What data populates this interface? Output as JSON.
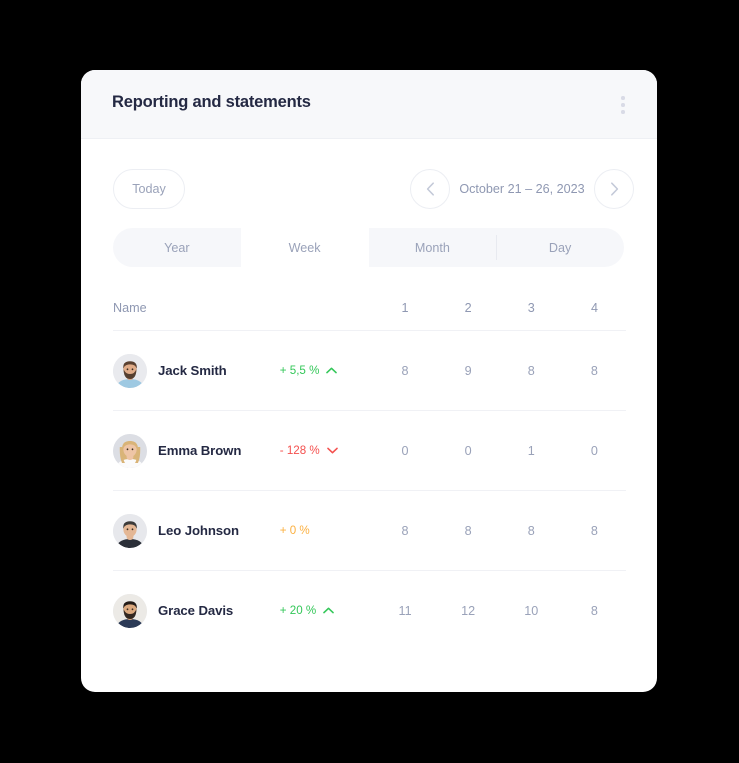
{
  "header": {
    "title": "Reporting and statements",
    "menu_icon": "kebab-vertical-icon"
  },
  "toolbar": {
    "today_label": "Today",
    "prev_icon": "chevron-left-icon",
    "next_icon": "chevron-right-icon",
    "date_range": "October 21 – 26, 2023"
  },
  "tabs": {
    "items": [
      {
        "label": "Year",
        "active": false
      },
      {
        "label": "Week",
        "active": true
      },
      {
        "label": "Month",
        "active": false
      },
      {
        "label": "Day",
        "active": false
      }
    ]
  },
  "table": {
    "columns": {
      "name": "Name",
      "delta": "",
      "days": [
        "1",
        "2",
        "3",
        "4"
      ]
    },
    "rows": [
      {
        "name": "Jack Smith",
        "avatar": "avatar-bearded-man-blue-shirt",
        "delta": "+ 5,5 %",
        "delta_color": "#34c759",
        "trend": "up",
        "values": [
          "8",
          "9",
          "8",
          "8"
        ]
      },
      {
        "name": "Emma Brown",
        "avatar": "avatar-blonde-woman-white-top",
        "delta": "- 128 %",
        "delta_color": "#f4504e",
        "trend": "down",
        "values": [
          "0",
          "0",
          "1",
          "0"
        ]
      },
      {
        "name": "Leo Johnson",
        "avatar": "avatar-short-hair-man-dark-shirt",
        "delta": "+ 0 %",
        "delta_color": "#fbb040",
        "trend": "none",
        "values": [
          "8",
          "8",
          "8",
          "8"
        ]
      },
      {
        "name": "Grace Davis",
        "avatar": "avatar-dark-hair-bearded-man-navy",
        "delta": "+ 20 %",
        "delta_color": "#34c759",
        "trend": "up",
        "values": [
          "11",
          "12",
          "10",
          "8"
        ]
      }
    ]
  },
  "colors": {
    "page_background": "#000000",
    "card_background": "#ffffff",
    "header_background": "#f7f8fa",
    "title_text": "#242943",
    "muted_text": "#9aa2b9",
    "divider": "#f0f1f5",
    "positive": "#34c759",
    "negative": "#f4504e",
    "neutral": "#fbb040"
  }
}
